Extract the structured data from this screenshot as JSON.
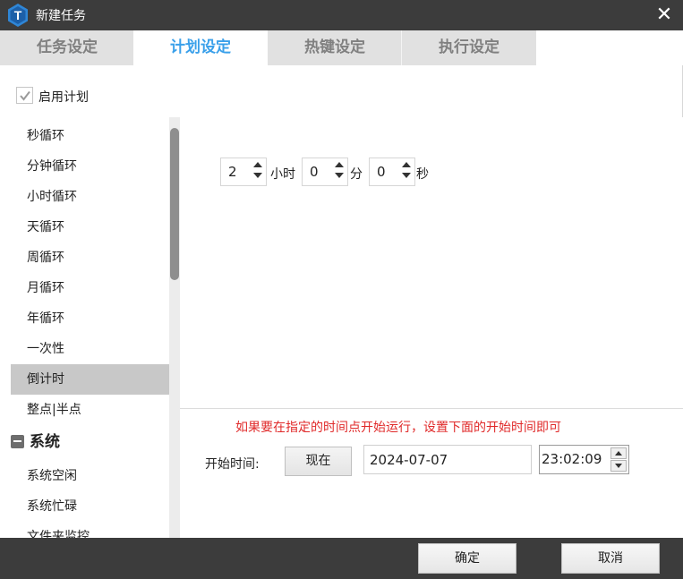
{
  "window": {
    "title": "新建任务",
    "close_glyph": "✕",
    "app_icon": "t-logo-icon",
    "app_icon_letter": "T"
  },
  "tabs": [
    {
      "label": "任务设定",
      "active": false
    },
    {
      "label": "计划设定",
      "active": true
    },
    {
      "label": "热键设定",
      "active": false
    },
    {
      "label": "执行设定",
      "active": false
    }
  ],
  "enable_schedule": {
    "label": "启用计划",
    "checked": true
  },
  "schedule_types": {
    "items": [
      "秒循环",
      "分钟循环",
      "小时循环",
      "天循环",
      "周循环",
      "月循环",
      "年循环",
      "一次性",
      "倒计时",
      "整点|半点"
    ],
    "selected": "倒计时",
    "group": {
      "label": "系统",
      "items": [
        "系统空闲",
        "系统忙碌",
        "文件夹监控"
      ]
    }
  },
  "countdown": {
    "hours": {
      "value": "2",
      "unit": "小时"
    },
    "minutes": {
      "value": "0",
      "unit": "分"
    },
    "seconds": {
      "value": "0",
      "unit": "秒"
    }
  },
  "start_time": {
    "hint": "如果要在指定的时间点开始运行，设置下面的开始时间即可",
    "label": "开始时间:",
    "now_button": "现在",
    "date": "2024-07-07",
    "time": "23:02:09"
  },
  "footer": {
    "ok_label": "确定",
    "cancel_label": "取消"
  },
  "colors": {
    "titlebar": "#3c3c3c",
    "active_tab_text": "#3aa0ea",
    "inactive_tab_bg": "#e1e1e1",
    "hint_text": "#e02a2a",
    "selected_item_bg": "#c8c8c8"
  }
}
